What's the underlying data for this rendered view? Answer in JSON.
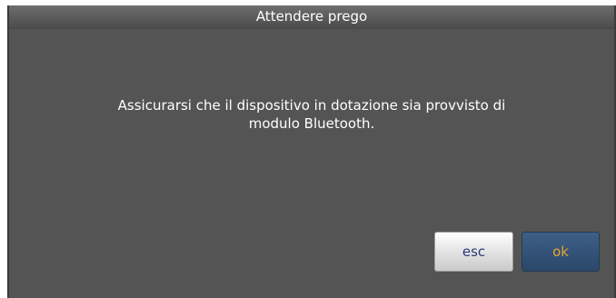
{
  "dialog": {
    "title": "Attendere prego",
    "message_line1": "Assicurarsi che il dispositivo in dotazione sia provvisto di",
    "message_line2": "modulo Bluetooth.",
    "buttons": {
      "esc_label": "esc",
      "ok_label": "ok"
    }
  },
  "colors": {
    "dialog_background": "#545454",
    "esc_text": "#2a3a74",
    "ok_background": "#2b476a",
    "ok_text": "#e4a82e"
  }
}
